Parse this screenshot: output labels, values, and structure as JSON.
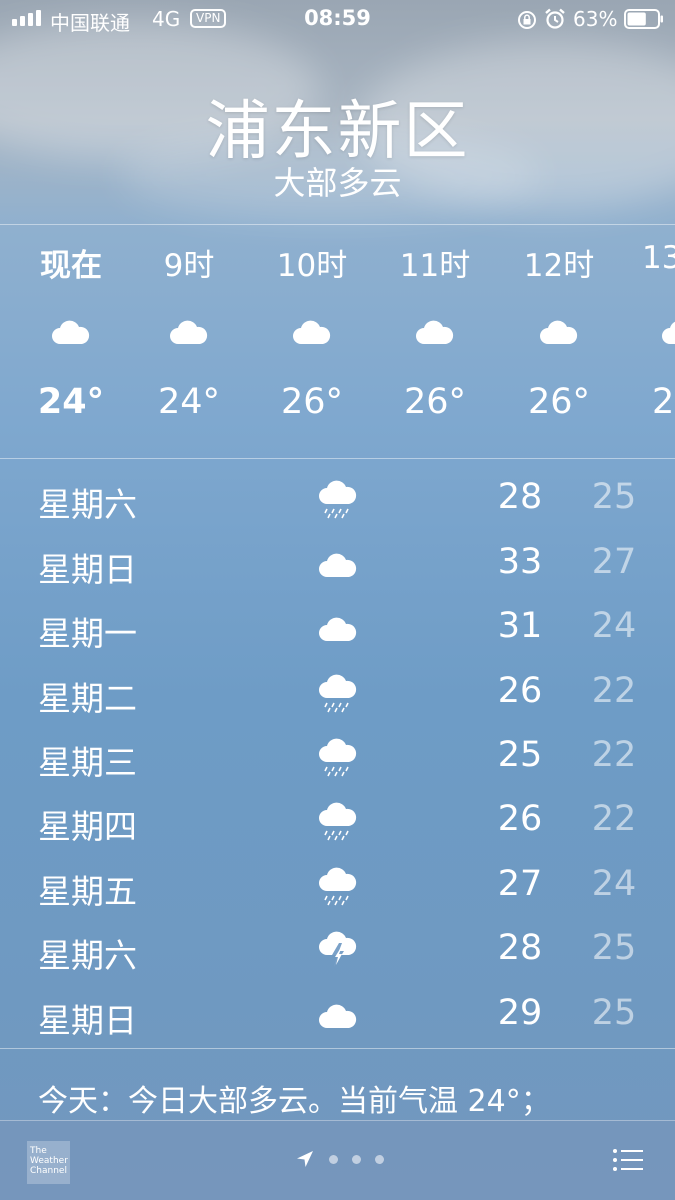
{
  "status_bar": {
    "carrier": "中国联通",
    "network": "4G",
    "vpn": "VPN",
    "time": "08:59",
    "battery": "63%",
    "battery_level": 0.63
  },
  "header": {
    "city": "浦东新区",
    "condition": "大部多云"
  },
  "hourly": [
    {
      "label": "现在",
      "icon": "cloud-icon",
      "temp": "24°"
    },
    {
      "label": "9时",
      "icon": "cloud-icon",
      "temp": "24°"
    },
    {
      "label": "10时",
      "icon": "cloud-icon",
      "temp": "26°"
    },
    {
      "label": "11时",
      "icon": "cloud-icon",
      "temp": "26°"
    },
    {
      "label": "12时",
      "icon": "cloud-icon",
      "temp": "26°"
    },
    {
      "label": "13",
      "icon": "cloud-icon",
      "temp": "2"
    }
  ],
  "daily": [
    {
      "day": "星期六",
      "icon": "rain-icon",
      "high": "28",
      "low": "25"
    },
    {
      "day": "星期日",
      "icon": "cloud-icon",
      "high": "33",
      "low": "27"
    },
    {
      "day": "星期一",
      "icon": "cloud-icon",
      "high": "31",
      "low": "24"
    },
    {
      "day": "星期二",
      "icon": "rain-icon",
      "high": "26",
      "low": "22"
    },
    {
      "day": "星期三",
      "icon": "rain-icon",
      "high": "25",
      "low": "22"
    },
    {
      "day": "星期四",
      "icon": "rain-icon",
      "high": "26",
      "low": "22"
    },
    {
      "day": "星期五",
      "icon": "rain-icon",
      "high": "27",
      "low": "24"
    },
    {
      "day": "星期六",
      "icon": "thunderstorm-icon",
      "high": "28",
      "low": "25"
    },
    {
      "day": "星期日",
      "icon": "cloud-icon",
      "high": "29",
      "low": "25"
    }
  ],
  "summary": "今天：今日大部多云。当前气温 24°；",
  "footer": {
    "logo_text": "The Weather Channel"
  }
}
